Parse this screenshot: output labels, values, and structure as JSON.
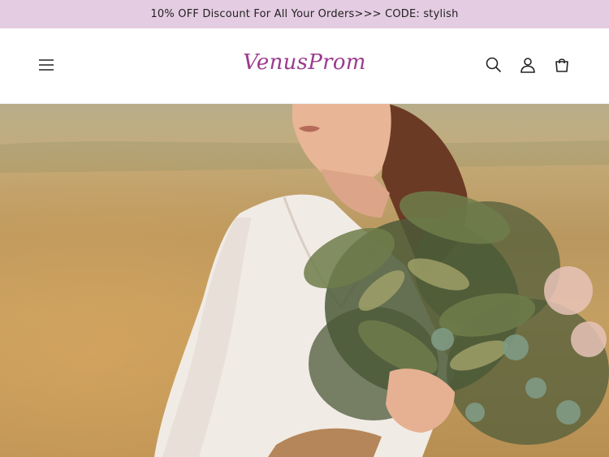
{
  "announcement": {
    "text": "10% OFF Discount For All Your Orders>>> CODE: stylish"
  },
  "header": {
    "logo_text": "VenusProm",
    "icons": {
      "menu": "hamburger-menu-icon",
      "search": "search-icon",
      "account": "user-icon",
      "cart": "cart-icon"
    }
  },
  "hero": {
    "image_subject": "bride-with-fern-bouquet",
    "colors": {
      "background": "#c2a773",
      "dress": "#f1ebe5",
      "foliage": "#4c5a38",
      "skin": "#e8b596"
    }
  },
  "colors": {
    "announcement_bg": "#e4cce2",
    "brand": "#9b3b8d",
    "icon": "#222222"
  }
}
